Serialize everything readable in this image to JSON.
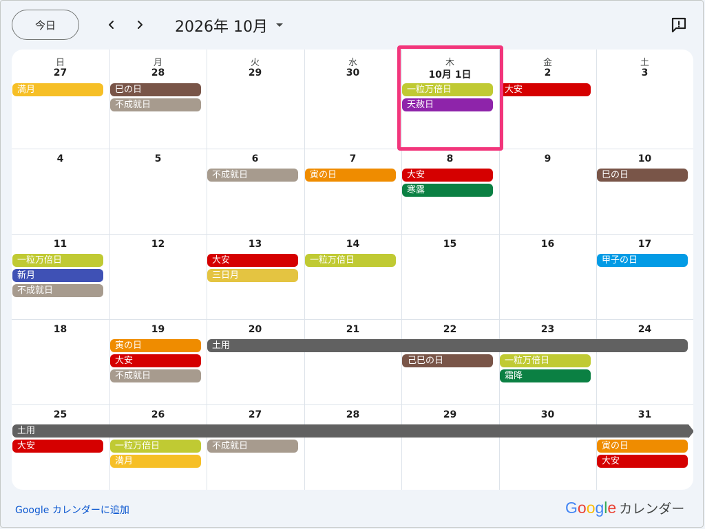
{
  "header": {
    "today_label": "今日",
    "month_title": "2026年 10月"
  },
  "weekdays": [
    "日",
    "月",
    "火",
    "水",
    "木",
    "金",
    "土"
  ],
  "weeks": [
    [
      "27",
      "28",
      "29",
      "30",
      "10月 1日",
      "2",
      "3"
    ],
    [
      "4",
      "5",
      "6",
      "7",
      "8",
      "9",
      "10"
    ],
    [
      "11",
      "12",
      "13",
      "14",
      "15",
      "16",
      "17"
    ],
    [
      "18",
      "19",
      "20",
      "21",
      "22",
      "23",
      "24"
    ],
    [
      "25",
      "26",
      "27",
      "28",
      "29",
      "30",
      "31"
    ]
  ],
  "events": [
    {
      "week": 0,
      "day": 0,
      "span": 1,
      "slot": 0,
      "label": "満月",
      "color": "#f6bf26"
    },
    {
      "week": 0,
      "day": 1,
      "span": 1,
      "slot": 0,
      "label": "巳の日",
      "color": "#795548"
    },
    {
      "week": 0,
      "day": 1,
      "span": 1,
      "slot": 1,
      "label": "不成就日",
      "color": "#a79b8e"
    },
    {
      "week": 0,
      "day": 4,
      "span": 1,
      "slot": 0,
      "label": "一粒万倍日",
      "color": "#c0ca33"
    },
    {
      "week": 0,
      "day": 4,
      "span": 1,
      "slot": 1,
      "label": "天赦日",
      "color": "#8e24aa"
    },
    {
      "week": 0,
      "day": 5,
      "span": 1,
      "slot": 0,
      "label": "大安",
      "color": "#d50000"
    },
    {
      "week": 1,
      "day": 2,
      "span": 1,
      "slot": 0,
      "label": "不成就日",
      "color": "#a79b8e"
    },
    {
      "week": 1,
      "day": 3,
      "span": 1,
      "slot": 0,
      "label": "寅の日",
      "color": "#ef8c00"
    },
    {
      "week": 1,
      "day": 4,
      "span": 1,
      "slot": 0,
      "label": "大安",
      "color": "#d50000"
    },
    {
      "week": 1,
      "day": 4,
      "span": 1,
      "slot": 1,
      "label": "寒露",
      "color": "#0b8043"
    },
    {
      "week": 1,
      "day": 6,
      "span": 1,
      "slot": 0,
      "label": "巳の日",
      "color": "#795548"
    },
    {
      "week": 2,
      "day": 0,
      "span": 1,
      "slot": 0,
      "label": "一粒万倍日",
      "color": "#c0ca33"
    },
    {
      "week": 2,
      "day": 0,
      "span": 1,
      "slot": 1,
      "label": "新月",
      "color": "#3f51b5"
    },
    {
      "week": 2,
      "day": 0,
      "span": 1,
      "slot": 2,
      "label": "不成就日",
      "color": "#a79b8e"
    },
    {
      "week": 2,
      "day": 2,
      "span": 1,
      "slot": 0,
      "label": "大安",
      "color": "#d50000"
    },
    {
      "week": 2,
      "day": 2,
      "span": 1,
      "slot": 1,
      "label": "三日月",
      "color": "#e4c441"
    },
    {
      "week": 2,
      "day": 3,
      "span": 1,
      "slot": 0,
      "label": "一粒万倍日",
      "color": "#c0ca33"
    },
    {
      "week": 2,
      "day": 6,
      "span": 1,
      "slot": 0,
      "label": "甲子の日",
      "color": "#039be5"
    },
    {
      "week": 3,
      "day": 1,
      "span": 1,
      "slot": 0,
      "label": "寅の日",
      "color": "#ef8c00"
    },
    {
      "week": 3,
      "day": 1,
      "span": 1,
      "slot": 1,
      "label": "大安",
      "color": "#d50000"
    },
    {
      "week": 3,
      "day": 1,
      "span": 1,
      "slot": 2,
      "label": "不成就日",
      "color": "#a79b8e"
    },
    {
      "week": 3,
      "day": 2,
      "span": 5,
      "slot": 0,
      "label": "土用",
      "color": "#616161"
    },
    {
      "week": 3,
      "day": 4,
      "span": 1,
      "slot": 1,
      "label": "己巳の日",
      "color": "#795548",
      "indent": true
    },
    {
      "week": 3,
      "day": 5,
      "span": 1,
      "slot": 1,
      "label": "一粒万倍日",
      "color": "#c0ca33"
    },
    {
      "week": 3,
      "day": 5,
      "span": 1,
      "slot": 2,
      "label": "霜降",
      "color": "#0b8043"
    },
    {
      "week": 4,
      "day": 0,
      "span": 7,
      "slot": 0,
      "label": "土用",
      "color": "#616161",
      "continues": true
    },
    {
      "week": 4,
      "day": 0,
      "span": 1,
      "slot": 1,
      "label": "大安",
      "color": "#d50000"
    },
    {
      "week": 4,
      "day": 1,
      "span": 1,
      "slot": 1,
      "label": "一粒万倍日",
      "color": "#c0ca33"
    },
    {
      "week": 4,
      "day": 1,
      "span": 1,
      "slot": 2,
      "label": "満月",
      "color": "#f6bf26"
    },
    {
      "week": 4,
      "day": 2,
      "span": 1,
      "slot": 1,
      "label": "不成就日",
      "color": "#a79b8e"
    },
    {
      "week": 4,
      "day": 6,
      "span": 1,
      "slot": 1,
      "label": "寅の日",
      "color": "#ef8c00"
    },
    {
      "week": 4,
      "day": 6,
      "span": 1,
      "slot": 2,
      "label": "大安",
      "color": "#d50000"
    }
  ],
  "footer": {
    "add_link": "Google カレンダーに追加",
    "brand_text": "カレンダー",
    "google_letters": [
      {
        "ch": "G",
        "color": "#4285f4"
      },
      {
        "ch": "o",
        "color": "#ea4335"
      },
      {
        "ch": "o",
        "color": "#fbbc05"
      },
      {
        "ch": "g",
        "color": "#4285f4"
      },
      {
        "ch": "l",
        "color": "#34a853"
      },
      {
        "ch": "e",
        "color": "#ea4335"
      }
    ]
  },
  "icons": {
    "prev": "chevron-left-icon",
    "next": "chevron-right-icon",
    "dropdown": "caret-down-icon",
    "feedback": "feedback-icon"
  }
}
